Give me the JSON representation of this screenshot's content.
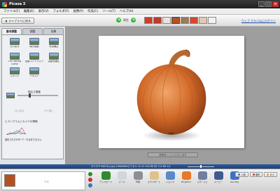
{
  "window": {
    "title": "Picasa 3",
    "min": "_",
    "max": "□",
    "close": "×"
  },
  "menu": [
    "ファイル(F)",
    "編集(E)",
    "表示(V)",
    "フォルダ(F)",
    "画像(P)",
    "作成(C)",
    "ツール(T)",
    "ヘルプ(H)"
  ],
  "toolbar": {
    "back_label": "ライブラリに戻る",
    "nav_label": "再生",
    "web_link": "ウェブ アルバムにログイン",
    "filmstrip_colors": [
      "#d23b2b",
      "#c0392b",
      "#e8e4dc",
      "#b5501f",
      "#9a7a5a",
      "#d24a2a",
      "#e2c9b0",
      "#f1f1f1"
    ]
  },
  "tabs": [
    "基本調整",
    "調整",
    "効果"
  ],
  "tools": [
    "切り抜き",
    "傾き調整",
    "赤目補正",
    "I'm Feeling Lucky",
    "自動コントラスト",
    "自動色補正",
    "レタッチ",
    "テキスト",
    ""
  ],
  "fill_light_label": "明るさ調整",
  "faded_buttons": [
    "元に戻す",
    "やり直し"
  ],
  "histogram": {
    "title": "ヒストグラムとカメラの情報",
    "note": "撮影されたEXIF データはありません"
  },
  "caption_placeholder": "説明をここに入力します",
  "info_strip": "タマネギ 00076_b.jpg 1000X680ピクセル 12:15 2012年1月 123 KB 1/1",
  "tray": {
    "placeholder": "写真",
    "actions": [
      {
        "label": "アップロード",
        "color": "#2e8b2e"
      },
      {
        "label": "メール",
        "color": "#cfd6de"
      },
      {
        "label": "印刷",
        "color": "#8a8f96"
      },
      {
        "label": "エクスポート",
        "color": "#dcc38a"
      },
      {
        "label": "ショップ",
        "color": "#5b88c9"
      },
      {
        "label": "BlogThis!",
        "color": "#e8782a"
      },
      {
        "label": "コラージュ",
        "color": "#6f7fa0"
      },
      {
        "label": "ムービー",
        "color": "#405c8c"
      },
      {
        "label": "Geo-Tag",
        "color": "#3b73c4"
      }
    ],
    "share_buttons": [
      "人物",
      "場所",
      "タグ"
    ]
  }
}
